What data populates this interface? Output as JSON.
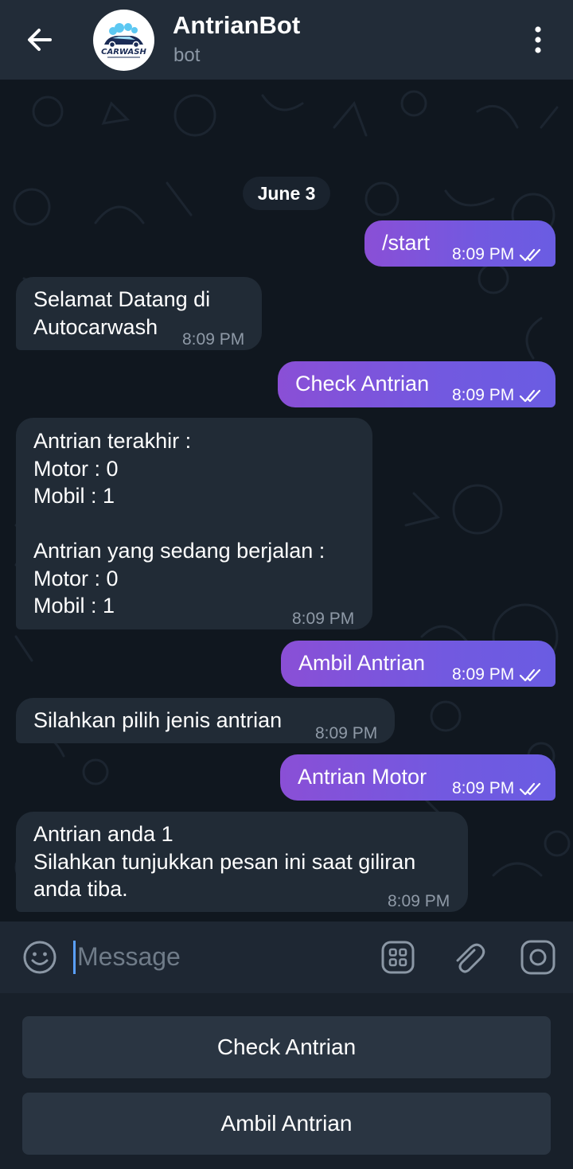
{
  "header": {
    "title": "AntrianBot",
    "subtitle": "bot",
    "avatar_logo_text": "CARWASH"
  },
  "chat": {
    "date": "June 3",
    "messages": [
      {
        "dir": "out",
        "text": "/start",
        "time": "8:09 PM"
      },
      {
        "dir": "in",
        "text": "Selamat Datang di\nAutocarwash",
        "time": "8:09 PM"
      },
      {
        "dir": "out",
        "text": "Check Antrian",
        "time": "8:09 PM"
      },
      {
        "dir": "in",
        "text": "Antrian terakhir :\nMotor : 0\nMobil : 1\n\nAntrian yang sedang berjalan :\nMotor : 0\nMobil : 1",
        "time": "8:09 PM"
      },
      {
        "dir": "out",
        "text": "Ambil Antrian",
        "time": "8:09 PM"
      },
      {
        "dir": "in",
        "text": "Silahkan pilih jenis antrian",
        "time": "8:09 PM"
      },
      {
        "dir": "out",
        "text": "Antrian Motor",
        "time": "8:09 PM"
      },
      {
        "dir": "in",
        "text": "Antrian anda 1\nSilahkan tunjukkan pesan ini saat giliran\nanda tiba.",
        "time": "8:09 PM"
      }
    ]
  },
  "input": {
    "placeholder": "Message"
  },
  "keyboard": {
    "buttons": [
      "Check Antrian",
      "Ambil Antrian"
    ]
  },
  "colors": {
    "outgoing_bubble": "#7a55dc",
    "incoming_bubble": "#212b36",
    "header": "#222c38",
    "background": "#10171f"
  },
  "icons": {
    "back": "arrow-left-icon",
    "menu": "more-vertical-icon",
    "emoji": "emoji-icon",
    "bot_commands": "bot-menu-icon",
    "attach": "paperclip-icon",
    "camera": "camera-icon",
    "read": "double-check-icon"
  }
}
